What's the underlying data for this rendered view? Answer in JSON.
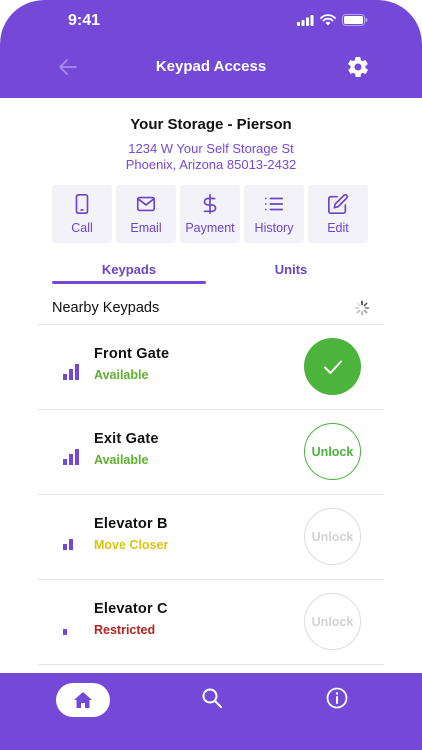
{
  "status_bar": {
    "time": "9:41"
  },
  "header": {
    "title": "Keypad Access"
  },
  "facility": {
    "name": "Your Storage - Pierson",
    "address_line1": "1234 W Your Self Storage St",
    "address_line2": "Phoenix, Arizona 85013-2432"
  },
  "actions": [
    {
      "label": "Call",
      "icon": "phone-icon"
    },
    {
      "label": "Email",
      "icon": "mail-icon"
    },
    {
      "label": "Payment",
      "icon": "dollar-icon"
    },
    {
      "label": "History",
      "icon": "list-icon"
    },
    {
      "label": "Edit",
      "icon": "edit-icon"
    }
  ],
  "tabs": [
    {
      "label": "Keypads",
      "active": true
    },
    {
      "label": "Units",
      "active": false
    }
  ],
  "section": {
    "title": "Nearby Keypads"
  },
  "keypads": [
    {
      "name": "Front Gate",
      "status": "Available",
      "status_color": "#5DB12E",
      "signal_bars": 3,
      "button": "",
      "state": "unlocked"
    },
    {
      "name": "Exit Gate",
      "status": "Available",
      "status_color": "#5DB12E",
      "signal_bars": 3,
      "button": "Unlock",
      "state": "ready"
    },
    {
      "name": "Elevator B",
      "status": "Move Closer",
      "status_color": "#D7C411",
      "signal_bars": 2,
      "button": "Unlock",
      "state": "disabled"
    },
    {
      "name": "Elevator C",
      "status": "Restricted",
      "status_color": "#B2261F",
      "signal_bars": 1,
      "button": "Unlock",
      "state": "disabled"
    }
  ],
  "colors": {
    "accent": "#7549D8",
    "success": "#4CB33D",
    "disabled": "#DCDCDC"
  }
}
